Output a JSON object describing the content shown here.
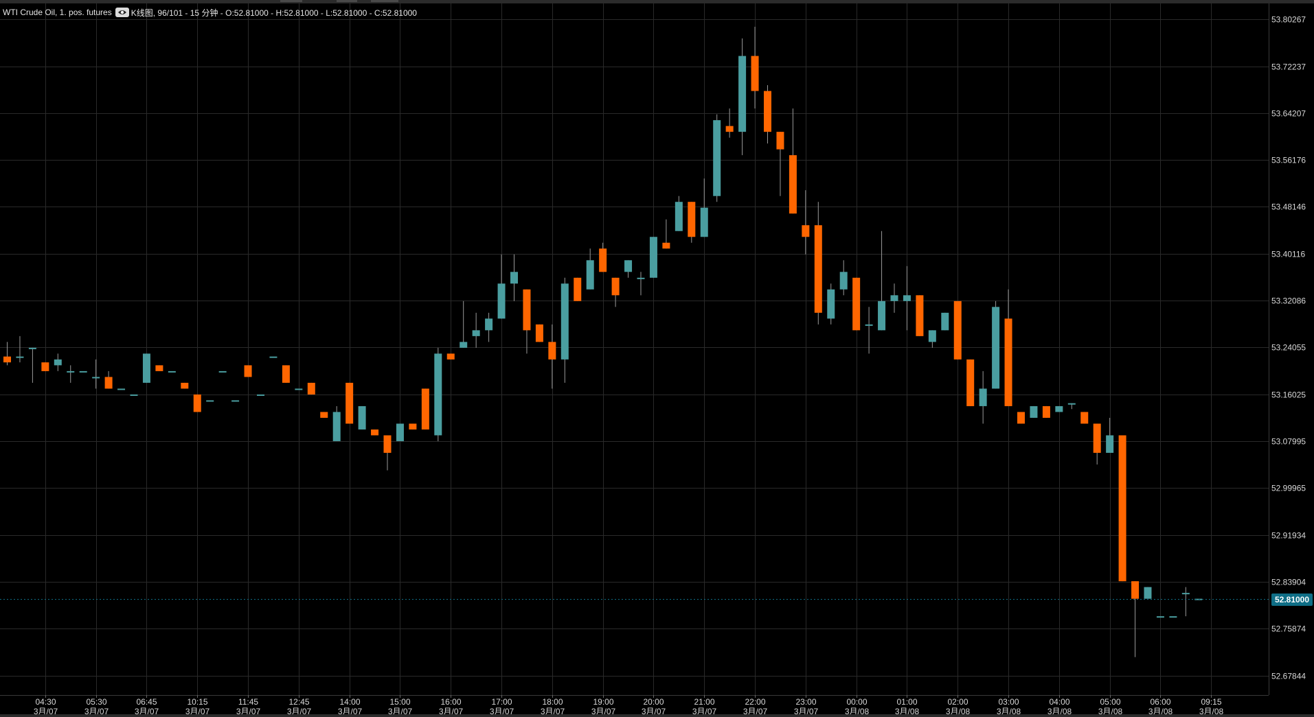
{
  "header": {
    "symbol": "WTI Crude Oil, 1. pos. futures",
    "chart_info": "K线图, 96/101 - 15 分钟 - O:52.81000 - H:52.81000 - L:52.81000 - C:52.81000"
  },
  "current_price_label": "52.81000",
  "colors": {
    "background": "#000000",
    "grid": "#2a2a2a",
    "up": "#4a9ea0",
    "down": "#ff6600",
    "wick": "#9a9a9a",
    "current_price": "#0f6e86",
    "axis_text": "#d8d8d8"
  },
  "chart_data": {
    "type": "candlestick",
    "title": "WTI Crude Oil, 1. pos. futures",
    "interval": "15 分钟",
    "current_price": 52.81,
    "ylim": [
      52.645,
      53.83
    ],
    "y_ticks": [
      "53.80267",
      "53.72237",
      "53.64207",
      "53.56176",
      "53.48146",
      "53.40116",
      "53.32086",
      "53.24055",
      "53.16025",
      "53.07995",
      "52.99965",
      "52.91934",
      "52.83904",
      "52.75874",
      "52.67844"
    ],
    "x_ticks": [
      {
        "i": 3,
        "time": "04:30",
        "date": "3月/07"
      },
      {
        "i": 7,
        "time": "05:30",
        "date": "3月/07"
      },
      {
        "i": 11,
        "time": "06:45",
        "date": "3月/07"
      },
      {
        "i": 15,
        "time": "10:15",
        "date": "3月/07"
      },
      {
        "i": 19,
        "time": "11:45",
        "date": "3月/07"
      },
      {
        "i": 23,
        "time": "12:45",
        "date": "3月/07"
      },
      {
        "i": 27,
        "time": "14:00",
        "date": "3月/07"
      },
      {
        "i": 31,
        "time": "15:00",
        "date": "3月/07"
      },
      {
        "i": 35,
        "time": "16:00",
        "date": "3月/07"
      },
      {
        "i": 39,
        "time": "17:00",
        "date": "3月/07"
      },
      {
        "i": 43,
        "time": "18:00",
        "date": "3月/07"
      },
      {
        "i": 47,
        "time": "19:00",
        "date": "3月/07"
      },
      {
        "i": 51,
        "time": "20:00",
        "date": "3月/07"
      },
      {
        "i": 55,
        "time": "21:00",
        "date": "3月/07"
      },
      {
        "i": 59,
        "time": "22:00",
        "date": "3月/07"
      },
      {
        "i": 63,
        "time": "23:00",
        "date": "3月/07"
      },
      {
        "i": 67,
        "time": "00:00",
        "date": "3月/08"
      },
      {
        "i": 71,
        "time": "01:00",
        "date": "3月/08"
      },
      {
        "i": 75,
        "time": "02:00",
        "date": "3月/08"
      },
      {
        "i": 79,
        "time": "03:00",
        "date": "3月/08"
      },
      {
        "i": 83,
        "time": "04:00",
        "date": "3月/08"
      },
      {
        "i": 87,
        "time": "05:00",
        "date": "3月/08"
      },
      {
        "i": 91,
        "time": "06:00",
        "date": "3月/08"
      },
      {
        "i": 95,
        "time": "09:15",
        "date": "3月/08"
      }
    ],
    "candles": [
      {
        "o": 53.225,
        "h": 53.25,
        "l": 53.21,
        "c": 53.215
      },
      {
        "o": 53.225,
        "h": 53.26,
        "l": 53.215,
        "c": 53.225
      },
      {
        "o": 53.24,
        "h": 53.24,
        "l": 53.18,
        "c": 53.24
      },
      {
        "o": 53.215,
        "h": 53.215,
        "l": 53.2,
        "c": 53.2
      },
      {
        "o": 53.21,
        "h": 53.23,
        "l": 53.2,
        "c": 53.22
      },
      {
        "o": 53.2,
        "h": 53.21,
        "l": 53.18,
        "c": 53.2
      },
      {
        "o": 53.2,
        "h": 53.2,
        "l": 53.2,
        "c": 53.2
      },
      {
        "o": 53.19,
        "h": 53.22,
        "l": 53.17,
        "c": 53.19
      },
      {
        "o": 53.19,
        "h": 53.2,
        "l": 53.17,
        "c": 53.17
      },
      {
        "o": 53.17,
        "h": 53.17,
        "l": 53.17,
        "c": 53.17
      },
      {
        "o": 53.16,
        "h": 53.16,
        "l": 53.16,
        "c": 53.16
      },
      {
        "o": 53.18,
        "h": 53.23,
        "l": 53.18,
        "c": 53.23
      },
      {
        "o": 53.21,
        "h": 53.21,
        "l": 53.2,
        "c": 53.2
      },
      {
        "o": 53.2,
        "h": 53.2,
        "l": 53.2,
        "c": 53.2
      },
      {
        "o": 53.18,
        "h": 53.18,
        "l": 53.17,
        "c": 53.17
      },
      {
        "o": 53.16,
        "h": 53.16,
        "l": 53.13,
        "c": 53.13
      },
      {
        "o": 53.15,
        "h": 53.15,
        "l": 53.15,
        "c": 53.15
      },
      {
        "o": 53.2,
        "h": 53.2,
        "l": 53.2,
        "c": 53.2
      },
      {
        "o": 53.15,
        "h": 53.15,
        "l": 53.15,
        "c": 53.15
      },
      {
        "o": 53.21,
        "h": 53.21,
        "l": 53.19,
        "c": 53.19
      },
      {
        "o": 53.16,
        "h": 53.16,
        "l": 53.16,
        "c": 53.16
      },
      {
        "o": 53.225,
        "h": 53.225,
        "l": 53.225,
        "c": 53.225
      },
      {
        "o": 53.21,
        "h": 53.21,
        "l": 53.18,
        "c": 53.18
      },
      {
        "o": 53.17,
        "h": 53.17,
        "l": 53.17,
        "c": 53.17
      },
      {
        "o": 53.18,
        "h": 53.18,
        "l": 53.16,
        "c": 53.16
      },
      {
        "o": 53.13,
        "h": 53.13,
        "l": 53.12,
        "c": 53.12
      },
      {
        "o": 53.08,
        "h": 53.14,
        "l": 53.08,
        "c": 53.13
      },
      {
        "o": 53.18,
        "h": 53.18,
        "l": 53.11,
        "c": 53.11
      },
      {
        "o": 53.1,
        "h": 53.14,
        "l": 53.1,
        "c": 53.14
      },
      {
        "o": 53.1,
        "h": 53.1,
        "l": 53.09,
        "c": 53.09
      },
      {
        "o": 53.09,
        "h": 53.09,
        "l": 53.03,
        "c": 53.06
      },
      {
        "o": 53.08,
        "h": 53.11,
        "l": 53.08,
        "c": 53.11
      },
      {
        "o": 53.11,
        "h": 53.11,
        "l": 53.1,
        "c": 53.1
      },
      {
        "o": 53.17,
        "h": 53.17,
        "l": 53.1,
        "c": 53.1
      },
      {
        "o": 53.09,
        "h": 53.24,
        "l": 53.08,
        "c": 53.23
      },
      {
        "o": 53.23,
        "h": 53.23,
        "l": 53.22,
        "c": 53.22
      },
      {
        "o": 53.24,
        "h": 53.32,
        "l": 53.24,
        "c": 53.25
      },
      {
        "o": 53.26,
        "h": 53.3,
        "l": 53.24,
        "c": 53.27
      },
      {
        "o": 53.27,
        "h": 53.3,
        "l": 53.25,
        "c": 53.29
      },
      {
        "o": 53.29,
        "h": 53.4,
        "l": 53.29,
        "c": 53.35
      },
      {
        "o": 53.35,
        "h": 53.4,
        "l": 53.32,
        "c": 53.37
      },
      {
        "o": 53.34,
        "h": 53.34,
        "l": 53.23,
        "c": 53.27
      },
      {
        "o": 53.28,
        "h": 53.28,
        "l": 53.25,
        "c": 53.25
      },
      {
        "o": 53.25,
        "h": 53.28,
        "l": 53.17,
        "c": 53.22
      },
      {
        "o": 53.22,
        "h": 53.36,
        "l": 53.18,
        "c": 53.35
      },
      {
        "o": 53.36,
        "h": 53.36,
        "l": 53.32,
        "c": 53.32
      },
      {
        "o": 53.34,
        "h": 53.41,
        "l": 53.34,
        "c": 53.39
      },
      {
        "o": 53.41,
        "h": 53.42,
        "l": 53.37,
        "c": 53.37
      },
      {
        "o": 53.36,
        "h": 53.36,
        "l": 53.31,
        "c": 53.33
      },
      {
        "o": 53.37,
        "h": 53.39,
        "l": 53.36,
        "c": 53.39
      },
      {
        "o": 53.36,
        "h": 53.37,
        "l": 53.33,
        "c": 53.36
      },
      {
        "o": 53.36,
        "h": 53.43,
        "l": 53.36,
        "c": 53.43
      },
      {
        "o": 53.42,
        "h": 53.46,
        "l": 53.41,
        "c": 53.41
      },
      {
        "o": 53.44,
        "h": 53.5,
        "l": 53.44,
        "c": 53.49
      },
      {
        "o": 53.49,
        "h": 53.49,
        "l": 53.42,
        "c": 53.43
      },
      {
        "o": 53.43,
        "h": 53.53,
        "l": 53.43,
        "c": 53.48
      },
      {
        "o": 53.5,
        "h": 53.64,
        "l": 53.49,
        "c": 53.63
      },
      {
        "o": 53.62,
        "h": 53.65,
        "l": 53.6,
        "c": 53.61
      },
      {
        "o": 53.61,
        "h": 53.77,
        "l": 53.57,
        "c": 53.74
      },
      {
        "o": 53.74,
        "h": 53.79,
        "l": 53.65,
        "c": 53.68
      },
      {
        "o": 53.68,
        "h": 53.69,
        "l": 53.59,
        "c": 53.61
      },
      {
        "o": 53.61,
        "h": 53.61,
        "l": 53.5,
        "c": 53.58
      },
      {
        "o": 53.57,
        "h": 53.65,
        "l": 53.47,
        "c": 53.47
      },
      {
        "o": 53.45,
        "h": 53.51,
        "l": 53.4,
        "c": 53.43
      },
      {
        "o": 53.45,
        "h": 53.49,
        "l": 53.28,
        "c": 53.3
      },
      {
        "o": 53.29,
        "h": 53.35,
        "l": 53.28,
        "c": 53.34
      },
      {
        "o": 53.34,
        "h": 53.39,
        "l": 53.33,
        "c": 53.37
      },
      {
        "o": 53.36,
        "h": 53.36,
        "l": 53.27,
        "c": 53.27
      },
      {
        "o": 53.28,
        "h": 53.31,
        "l": 53.23,
        "c": 53.28
      },
      {
        "o": 53.27,
        "h": 53.44,
        "l": 53.27,
        "c": 53.32
      },
      {
        "o": 53.32,
        "h": 53.35,
        "l": 53.3,
        "c": 53.33
      },
      {
        "o": 53.32,
        "h": 53.38,
        "l": 53.27,
        "c": 53.33
      },
      {
        "o": 53.33,
        "h": 53.33,
        "l": 53.26,
        "c": 53.26
      },
      {
        "o": 53.25,
        "h": 53.27,
        "l": 53.24,
        "c": 53.27
      },
      {
        "o": 53.27,
        "h": 53.3,
        "l": 53.27,
        "c": 53.3
      },
      {
        "o": 53.32,
        "h": 53.32,
        "l": 53.22,
        "c": 53.22
      },
      {
        "o": 53.22,
        "h": 53.22,
        "l": 53.14,
        "c": 53.14
      },
      {
        "o": 53.14,
        "h": 53.2,
        "l": 53.11,
        "c": 53.17
      },
      {
        "o": 53.17,
        "h": 53.32,
        "l": 53.17,
        "c": 53.31
      },
      {
        "o": 53.29,
        "h": 53.34,
        "l": 53.14,
        "c": 53.14
      },
      {
        "o": 53.13,
        "h": 53.13,
        "l": 53.11,
        "c": 53.11
      },
      {
        "o": 53.12,
        "h": 53.14,
        "l": 53.12,
        "c": 53.14
      },
      {
        "o": 53.14,
        "h": 53.14,
        "l": 53.12,
        "c": 53.12
      },
      {
        "o": 53.13,
        "h": 53.14,
        "l": 53.13,
        "c": 53.14
      },
      {
        "o": 53.145,
        "h": 53.145,
        "l": 53.135,
        "c": 53.145
      },
      {
        "o": 53.13,
        "h": 53.13,
        "l": 53.11,
        "c": 53.11
      },
      {
        "o": 53.11,
        "h": 53.11,
        "l": 53.04,
        "c": 53.06
      },
      {
        "o": 53.06,
        "h": 53.12,
        "l": 53.06,
        "c": 53.09
      },
      {
        "o": 53.09,
        "h": 53.09,
        "l": 52.84,
        "c": 52.84
      },
      {
        "o": 52.84,
        "h": 52.84,
        "l": 52.71,
        "c": 52.81
      },
      {
        "o": 52.81,
        "h": 52.83,
        "l": 52.81,
        "c": 52.83
      },
      {
        "o": 52.78,
        "h": 52.78,
        "l": 52.78,
        "c": 52.78
      },
      {
        "o": 52.78,
        "h": 52.78,
        "l": 52.78,
        "c": 52.78
      },
      {
        "o": 52.82,
        "h": 52.83,
        "l": 52.78,
        "c": 52.82
      },
      {
        "o": 52.81,
        "h": 52.81,
        "l": 52.81,
        "c": 52.81
      }
    ]
  }
}
